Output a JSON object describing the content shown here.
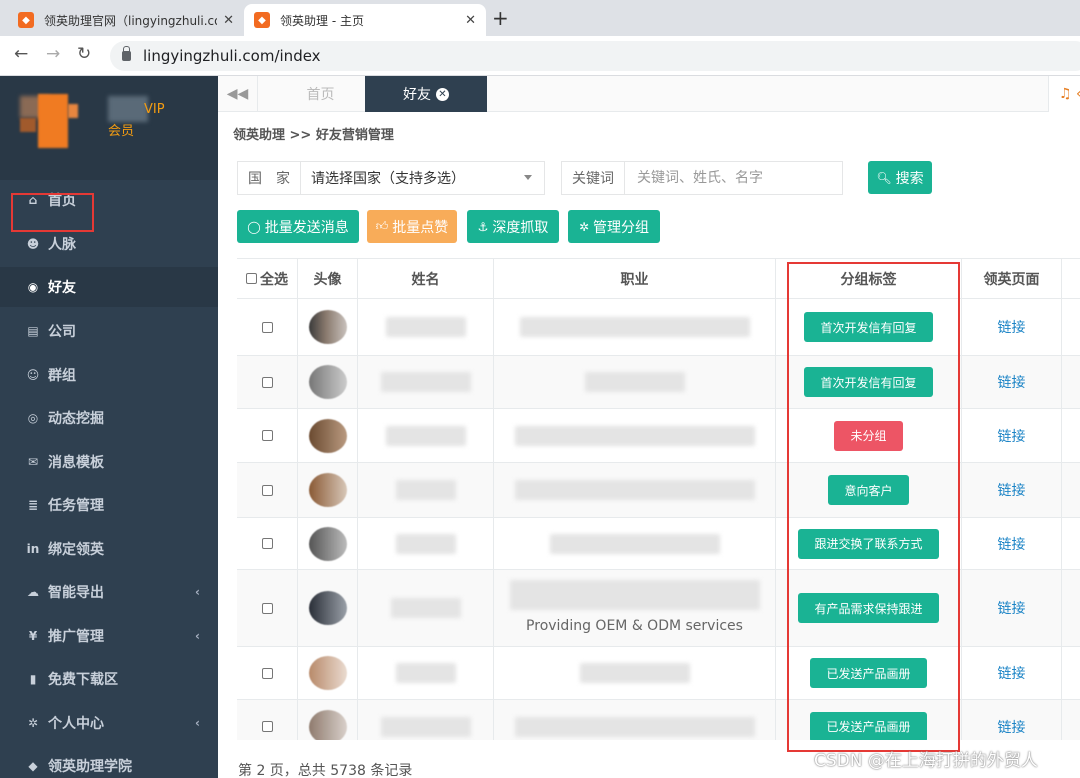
{
  "browser": {
    "tabs": [
      {
        "title": "领英助理官网（lingyingzhuli.co",
        "close": "✕"
      },
      {
        "title": "领英助理 - 主页",
        "close": "✕"
      }
    ],
    "new_tab": "+",
    "url": "lingyingzhuli.com/index"
  },
  "sidebar": {
    "vip_text": "VIP",
    "member_text": "会员",
    "items": [
      {
        "label": "首页",
        "icon": "home-icon",
        "glyph": "⌂"
      },
      {
        "label": "人脉",
        "icon": "user-plus-icon",
        "glyph": "☻"
      },
      {
        "label": "好友",
        "icon": "comments-icon",
        "glyph": "◉"
      },
      {
        "label": "公司",
        "icon": "briefcase-icon",
        "glyph": "▤"
      },
      {
        "label": "群组",
        "icon": "users-icon",
        "glyph": "☺"
      },
      {
        "label": "动态挖掘",
        "icon": "target-icon",
        "glyph": "◎"
      },
      {
        "label": "消息模板",
        "icon": "envelope-icon",
        "glyph": "✉"
      },
      {
        "label": "任务管理",
        "icon": "tasks-icon",
        "glyph": "≣"
      },
      {
        "label": "绑定领英",
        "icon": "linkedin-icon",
        "glyph": "in"
      },
      {
        "label": "智能导出",
        "icon": "cloud-download-icon",
        "glyph": "☁"
      },
      {
        "label": "推广管理",
        "icon": "yen-icon",
        "glyph": "¥"
      },
      {
        "label": "免费下载区",
        "icon": "file-icon",
        "glyph": "▮"
      },
      {
        "label": "个人中心",
        "icon": "gear-icon",
        "glyph": "✲"
      },
      {
        "label": "领英助理学院",
        "icon": "graduation-cap-icon",
        "glyph": "◆"
      }
    ],
    "submenu_chevron": "‹"
  },
  "content_tabs": {
    "back": "◀◀",
    "home": "首页",
    "friends": "好友",
    "friends_close": "✕",
    "right": "♫ ‹"
  },
  "breadcrumb": "领英助理 >> 好友营销管理",
  "search": {
    "country_label": "国　家",
    "country_value": "请选择国家（支持多选）",
    "keyword_label": "关键词",
    "keyword_placeholder": "关键词、姓氏、名字",
    "search_button": "搜索"
  },
  "actions": {
    "bulk_message": "批量发送消息",
    "bulk_like": "批量点赞",
    "deep_crawl": "深度抓取",
    "manage_groups": "管理分组"
  },
  "table": {
    "headers": {
      "select_all": "全选",
      "avatar": "头像",
      "name": "姓名",
      "job": "职业",
      "group_tag": "分组标签",
      "linkedin_page": "领英页面"
    },
    "rows": [
      {
        "job_text": "",
        "tag": "首次开发信有回复",
        "tag_color": "#1ab394",
        "link": "链接"
      },
      {
        "job_text": "",
        "tag": "首次开发信有回复",
        "tag_color": "#1ab394",
        "link": "链接"
      },
      {
        "job_text": "",
        "tag": "未分组",
        "tag_color": "#ed5565",
        "link": "链接"
      },
      {
        "job_text": "",
        "tag": "意向客户",
        "tag_color": "#1ab394",
        "link": "链接"
      },
      {
        "job_text": "",
        "tag": "跟进交换了联系方式",
        "tag_color": "#1ab394",
        "link": "链接"
      },
      {
        "job_text": "Providing OEM & ODM services",
        "tag": "有产品需求保持跟进",
        "tag_color": "#1ab394",
        "link": "链接"
      },
      {
        "job_text": "",
        "tag": "已发送产品画册",
        "tag_color": "#1ab394",
        "link": "链接"
      },
      {
        "job_text": "",
        "tag": "已发送产品画册",
        "tag_color": "#1ab394",
        "link": "链接"
      }
    ]
  },
  "footer": "第 2 页，总共 5738 条记录",
  "watermark": "CSDN @在上海打拼的外贸人",
  "colors": {
    "sidebar_bg": "#2f4050",
    "accent_teal": "#1ab394",
    "accent_orange": "#f8ac59",
    "tag_red": "#ed5565",
    "link_blue": "#1c84c6",
    "highlight_red": "#e53935"
  }
}
